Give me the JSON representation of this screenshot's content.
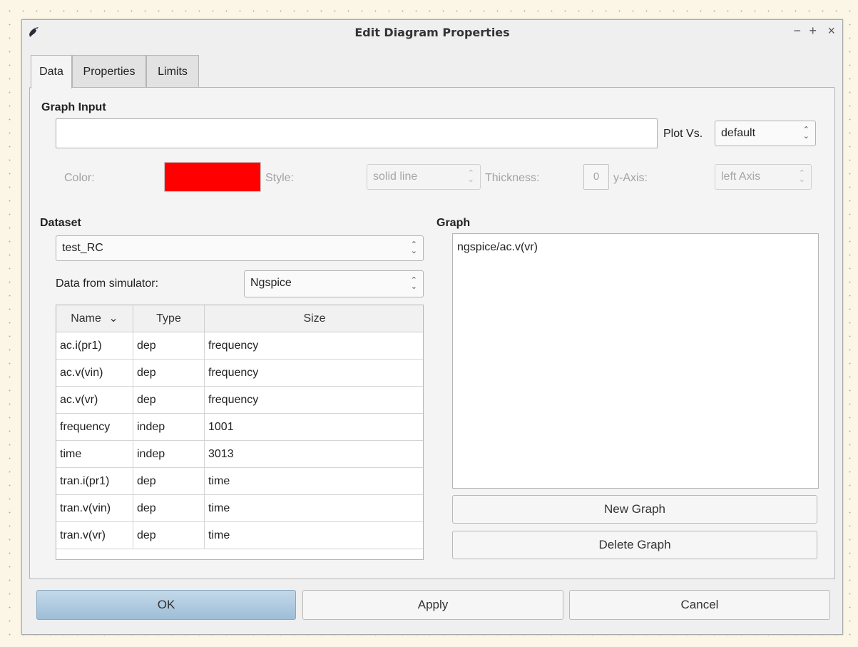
{
  "window": {
    "title": "Edit Diagram Properties",
    "icon": "bird-app-icon",
    "controls": {
      "minimize": "−",
      "maximize": "+",
      "close": "×"
    }
  },
  "tabs": [
    {
      "label": "Data",
      "active": true
    },
    {
      "label": "Properties",
      "active": false
    },
    {
      "label": "Limits",
      "active": false
    }
  ],
  "graph_input": {
    "title": "Graph Input",
    "value": "",
    "plot_vs_label": "Plot Vs.",
    "plot_vs_value": "default",
    "color_label": "Color:",
    "color_value": "#ff0000",
    "style_label": "Style:",
    "style_value": "solid line",
    "thickness_label": "Thickness:",
    "thickness_value": "0",
    "yaxis_label": "y-Axis:",
    "yaxis_value": "left Axis"
  },
  "dataset": {
    "title": "Dataset",
    "selected": "test_RC",
    "simulator_label": "Data from simulator:",
    "simulator_value": "Ngspice",
    "columns": [
      "Name",
      "Type",
      "Size"
    ],
    "sort_indicator": "⌄",
    "rows": [
      [
        "ac.i(pr1)",
        "dep",
        "frequency"
      ],
      [
        "ac.v(vin)",
        "dep",
        "frequency"
      ],
      [
        "ac.v(vr)",
        "dep",
        "frequency"
      ],
      [
        "frequency",
        "indep",
        "1001"
      ],
      [
        "time",
        "indep",
        "3013"
      ],
      [
        "tran.i(pr1)",
        "dep",
        "time"
      ],
      [
        "tran.v(vin)",
        "dep",
        "time"
      ],
      [
        "tran.v(vr)",
        "dep",
        "time"
      ]
    ]
  },
  "graph": {
    "title": "Graph",
    "items": [
      "ngspice/ac.v(vr)"
    ],
    "new_button": "New Graph",
    "delete_button": "Delete Graph"
  },
  "buttons": {
    "ok": "OK",
    "apply": "Apply",
    "cancel": "Cancel"
  }
}
